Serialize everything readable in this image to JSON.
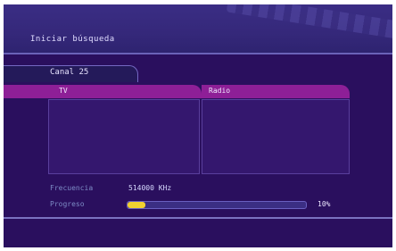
{
  "header": {
    "title": "Iniciar búsqueda"
  },
  "channel": {
    "label": "Canal 25"
  },
  "tabs": {
    "tv": "TV",
    "radio": "Radio"
  },
  "scan": {
    "frequency_label": "Frecuencia",
    "frequency_value": "514000 KHz",
    "progress_label": "Progreso",
    "progress_percent_text": "10%",
    "progress_fraction": 0.1
  },
  "colors": {
    "background": "#2a0f5e",
    "tab_accent": "#8e1f97",
    "progress_fill": "#f1d130"
  }
}
